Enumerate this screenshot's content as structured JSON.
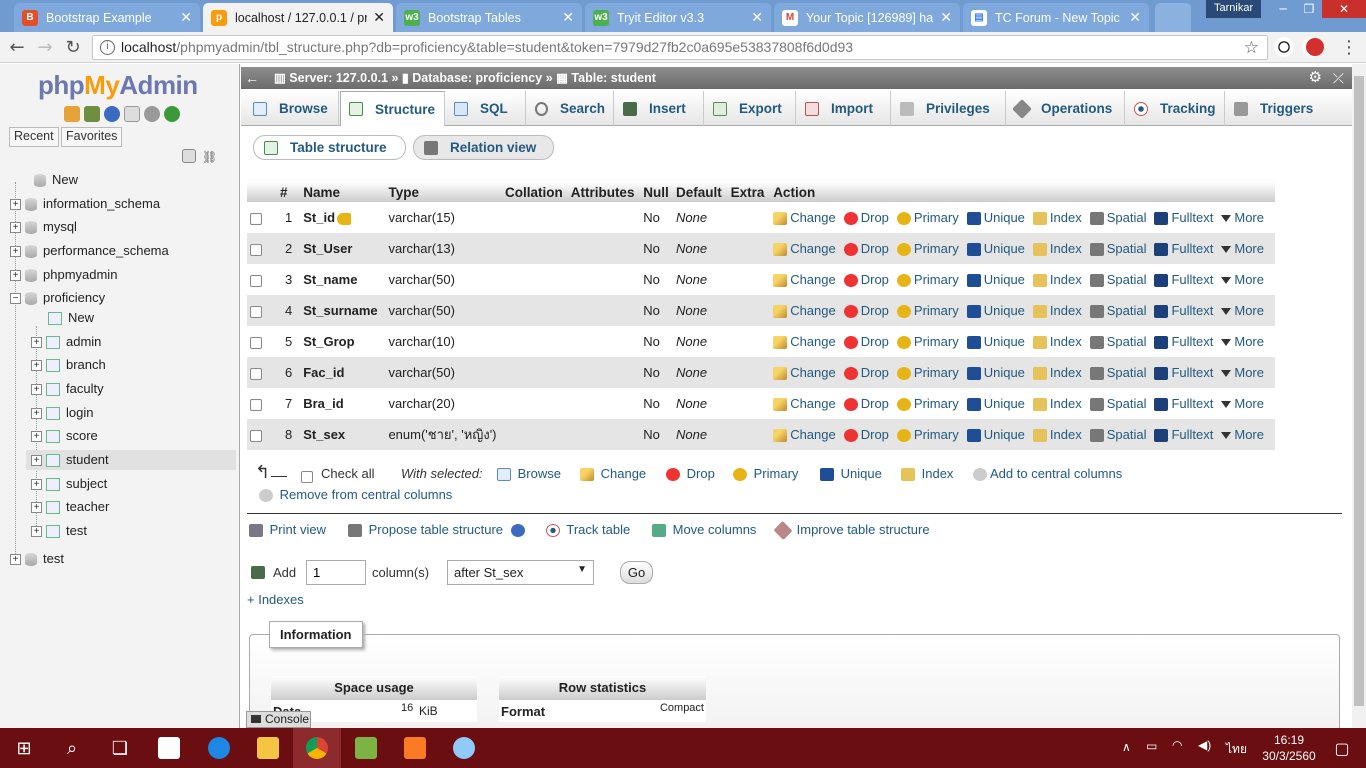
{
  "browser": {
    "tabs": [
      {
        "title": "Bootstrap Example",
        "icon_color": "#e34f26"
      },
      {
        "title": "localhost / 127.0.0.1 / pr",
        "icon_color": "#f89c0e"
      },
      {
        "title": "Bootstrap Tables",
        "icon_color": "#4caf50"
      },
      {
        "title": "Tryit Editor v3.3",
        "icon_color": "#4caf50"
      },
      {
        "title": "Your Topic [126989] ha",
        "icon_color": "#d44638"
      },
      {
        "title": "TC Forum - New Topic",
        "icon_color": "#4285f4"
      }
    ],
    "profile": "Tarnikar",
    "url": "localhost/phpmyadmin/tbl_structure.php?db=proficiency&table=student&token=7979d27fb2c0a695e53837808f6d0d93",
    "url_host": "localhost",
    "url_rest": "/phpmyadmin/tbl_structure.php?db=proficiency&table=student&token=7979d27fb2c0a695e53837808f6d0d93"
  },
  "sidebar": {
    "logo_php": "php",
    "logo_my": "My",
    "logo_admin": "Admin",
    "recent": "Recent",
    "favorites": "Favorites",
    "tree": [
      {
        "label": "New",
        "type": "new"
      },
      {
        "label": "information_schema",
        "type": "db"
      },
      {
        "label": "mysql",
        "type": "db"
      },
      {
        "label": "performance_schema",
        "type": "db"
      },
      {
        "label": "phpmyadmin",
        "type": "db"
      },
      {
        "label": "proficiency",
        "type": "db-open"
      },
      {
        "label": "New",
        "type": "new-sub"
      },
      {
        "label": "admin",
        "type": "table"
      },
      {
        "label": "branch",
        "type": "table"
      },
      {
        "label": "faculty",
        "type": "table"
      },
      {
        "label": "login",
        "type": "table"
      },
      {
        "label": "score",
        "type": "table"
      },
      {
        "label": "student",
        "type": "table-selected"
      },
      {
        "label": "subject",
        "type": "table"
      },
      {
        "label": "teacher",
        "type": "table"
      },
      {
        "label": "test",
        "type": "table"
      },
      {
        "label": "test",
        "type": "db"
      }
    ]
  },
  "breadcrumb": {
    "server": "Server: 127.0.0.1",
    "database": "Database: proficiency",
    "table": "Table: student"
  },
  "menu": {
    "tabs": [
      "Browse",
      "Structure",
      "SQL",
      "Search",
      "Insert",
      "Export",
      "Import",
      "Privileges",
      "Operations",
      "Tracking",
      "Triggers"
    ],
    "active": "Structure"
  },
  "subtabs": [
    "Table structure",
    "Relation view"
  ],
  "structure": {
    "columns": [
      "",
      "#",
      "Name",
      "Type",
      "Collation",
      "Attributes",
      "Null",
      "Default",
      "Extra",
      "Action"
    ],
    "rows": [
      {
        "num": "1",
        "name": "St_id",
        "type": "varchar(15)",
        "null": "No",
        "default": "None",
        "primary_key": true
      },
      {
        "num": "2",
        "name": "St_User",
        "type": "varchar(13)",
        "null": "No",
        "default": "None",
        "primary_key": false
      },
      {
        "num": "3",
        "name": "St_name",
        "type": "varchar(50)",
        "null": "No",
        "default": "None",
        "primary_key": false
      },
      {
        "num": "4",
        "name": "St_surname",
        "type": "varchar(50)",
        "null": "No",
        "default": "None",
        "primary_key": false
      },
      {
        "num": "5",
        "name": "St_Grop",
        "type": "varchar(10)",
        "null": "No",
        "default": "None",
        "primary_key": false
      },
      {
        "num": "6",
        "name": "Fac_id",
        "type": "varchar(50)",
        "null": "No",
        "default": "None",
        "primary_key": false
      },
      {
        "num": "7",
        "name": "Bra_id",
        "type": "varchar(20)",
        "null": "No",
        "default": "None",
        "primary_key": false
      },
      {
        "num": "8",
        "name": "St_sex",
        "type": "enum('ชาย', 'หญิง')",
        "null": "No",
        "default": "None",
        "primary_key": false
      }
    ],
    "actions": [
      "Change",
      "Drop",
      "Primary",
      "Unique",
      "Index",
      "Spatial",
      "Fulltext",
      "More"
    ]
  },
  "with_selected": {
    "check_all": "Check all",
    "label": "With selected:",
    "items": [
      "Browse",
      "Change",
      "Drop",
      "Primary",
      "Unique",
      "Index",
      "Add to central columns",
      "Remove from central columns"
    ]
  },
  "actions_bar": [
    "Print view",
    "Propose table structure",
    "Track table",
    "Move columns",
    "Improve table structure"
  ],
  "add_column": {
    "label": "Add",
    "value": "1",
    "unit": "column(s)",
    "position": "after St_sex",
    "go": "Go"
  },
  "indexes_link": "+ Indexes",
  "information": {
    "legend": "Information",
    "space_usage": "Space usage",
    "row_statistics": "Row statistics",
    "data_label": "Data",
    "data_value": "16",
    "data_unit": "KiB",
    "format_label": "Format",
    "format_value": "Compact"
  },
  "console": "Console",
  "taskbar": {
    "lang": "ไทย",
    "time": "16:19",
    "date": "30/3/2560"
  }
}
